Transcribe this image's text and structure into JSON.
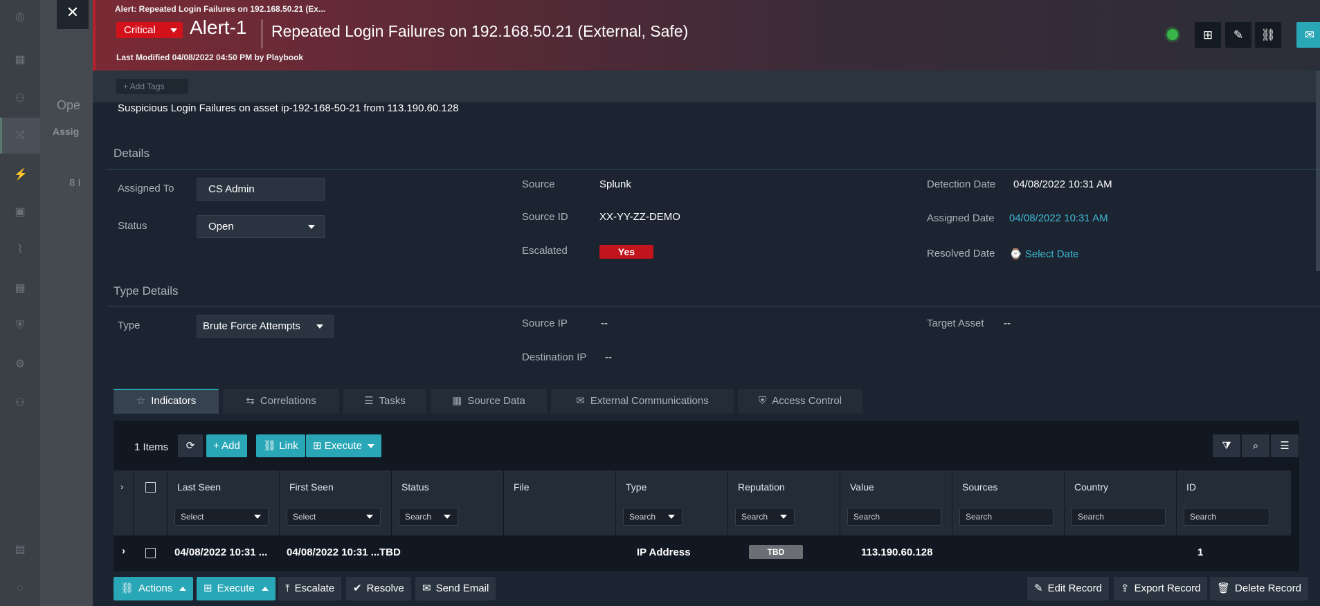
{
  "background": {
    "panel_text_1": "Ope",
    "panel_text_2": "Assig",
    "panel_text_3": "8 I"
  },
  "header": {
    "breadcrumb": "Alert: Repeated Login Failures on 192.168.50.21 (Ex...",
    "severity": "Critical",
    "alert_id": "Alert-1",
    "title": "Repeated Login Failures on 192.168.50.21 (External, Safe)",
    "last_modified": "Last Modified 04/08/2022 04:50 PM by Playbook"
  },
  "tags": {
    "add_label": "+ Add Tags"
  },
  "description": "Suspicious Login Failures on asset ip-192-168-50-21 from 113.190.60.128",
  "details": {
    "section_title": "Details",
    "assigned_to_label": "Assigned To",
    "assigned_to_value": "CS Admin",
    "status_label": "Status",
    "status_value": "Open",
    "source_label": "Source",
    "source_value": "Splunk",
    "source_id_label": "Source ID",
    "source_id_value": "XX-YY-ZZ-DEMO",
    "escalated_label": "Escalated",
    "escalated_value": "Yes",
    "detection_date_label": "Detection Date",
    "detection_date_value": "04/08/2022 10:31 AM",
    "assigned_date_label": "Assigned Date",
    "assigned_date_value": "04/08/2022 10:31 AM",
    "resolved_date_label": "Resolved Date",
    "resolved_date_value": "Select Date"
  },
  "type_details": {
    "section_title": "Type Details",
    "type_label": "Type",
    "type_value": "Brute Force Attempts",
    "source_ip_label": "Source IP",
    "source_ip_value": "--",
    "destination_ip_label": "Destination IP",
    "destination_ip_value": "--",
    "target_asset_label": "Target Asset",
    "target_asset_value": "--"
  },
  "tabs": [
    {
      "label": "Indicators"
    },
    {
      "label": "Correlations"
    },
    {
      "label": "Tasks"
    },
    {
      "label": "Source Data"
    },
    {
      "label": "External Communications"
    },
    {
      "label": "Access Control"
    }
  ],
  "grid": {
    "items_count": "1 Items",
    "add_label": "Add",
    "link_label": "Link",
    "execute_label": "Execute",
    "columns": [
      {
        "label": "Last Seen",
        "filter": "Select"
      },
      {
        "label": "First Seen",
        "filter": "Select"
      },
      {
        "label": "Status",
        "filter": "Search"
      },
      {
        "label": "File",
        "filter": ""
      },
      {
        "label": "Type",
        "filter": "Search"
      },
      {
        "label": "Reputation",
        "filter": "Search"
      },
      {
        "label": "Value",
        "filter": "Search"
      },
      {
        "label": "Sources",
        "filter": "Search"
      },
      {
        "label": "Country",
        "filter": "Search"
      },
      {
        "label": "ID",
        "filter": "Search"
      }
    ],
    "row": {
      "last_seen": "04/08/2022 10:31 ...",
      "first_seen": "04/08/2022 10:31 ...",
      "status": "TBD",
      "type": "IP Address",
      "reputation": "TBD",
      "value": "113.190.60.128",
      "id": "1"
    }
  },
  "footer": {
    "actions": "Actions",
    "execute": "Execute",
    "escalate": "Escalate",
    "resolve": "Resolve",
    "send_email": "Send Email",
    "edit_record": "Edit Record",
    "export_record": "Export Record",
    "delete_record": "Delete Record"
  },
  "colors": {
    "critical": "#d3111b",
    "accent": "#2aa7b7",
    "link": "#3fb7d2",
    "online": "#39b54a"
  }
}
